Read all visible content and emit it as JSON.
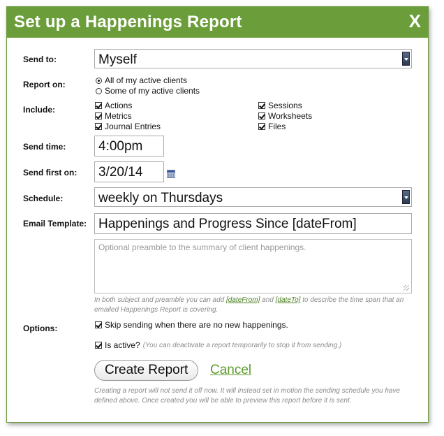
{
  "dialog": {
    "title": "Set up a Happenings Report",
    "close": "X"
  },
  "send_to": {
    "label": "Send to:",
    "value": "Myself"
  },
  "report_on": {
    "label": "Report on:",
    "options": [
      "All of my active clients",
      "Some of my active clients"
    ],
    "selected": 0
  },
  "include": {
    "label": "Include:",
    "items": [
      {
        "label": "Actions",
        "checked": true
      },
      {
        "label": "Metrics",
        "checked": true
      },
      {
        "label": "Journal Entries",
        "checked": true
      },
      {
        "label": "Sessions",
        "checked": true
      },
      {
        "label": "Worksheets",
        "checked": true
      },
      {
        "label": "Files",
        "checked": true
      }
    ]
  },
  "send_time": {
    "label": "Send time:",
    "value": "4:00pm"
  },
  "send_first_on": {
    "label": "Send first on:",
    "value": "3/20/14",
    "icon": "calendar-icon"
  },
  "schedule": {
    "label": "Schedule:",
    "value": "weekly on Thursdays"
  },
  "email_template": {
    "label": "Email Template:",
    "subject": "Happenings and Progress Since [dateFrom]",
    "preamble_placeholder": "Optional preamble to the summary of client happenings.",
    "hint_before": "In both subject and preamble you can add ",
    "hint_link1": "[dateFrom]",
    "hint_and": " and ",
    "hint_link2": "[dateTo]",
    "hint_after": " to describe the time span that an emailed Happenings Report is covering."
  },
  "options": {
    "label": "Options:",
    "skip_label": "Skip sending when there are no new happenings.",
    "skip_checked": true,
    "active_label": "Is active?",
    "active_hint": "(You can deactivate a report temporarily to stop it from sending.)",
    "active_checked": true
  },
  "actions": {
    "create": "Create Report",
    "cancel": "Cancel",
    "footer": "Creating a report will not send it off now. It will instead set in motion the sending schedule you have defined above. Once created you will be able to preview this report before it is sent."
  }
}
